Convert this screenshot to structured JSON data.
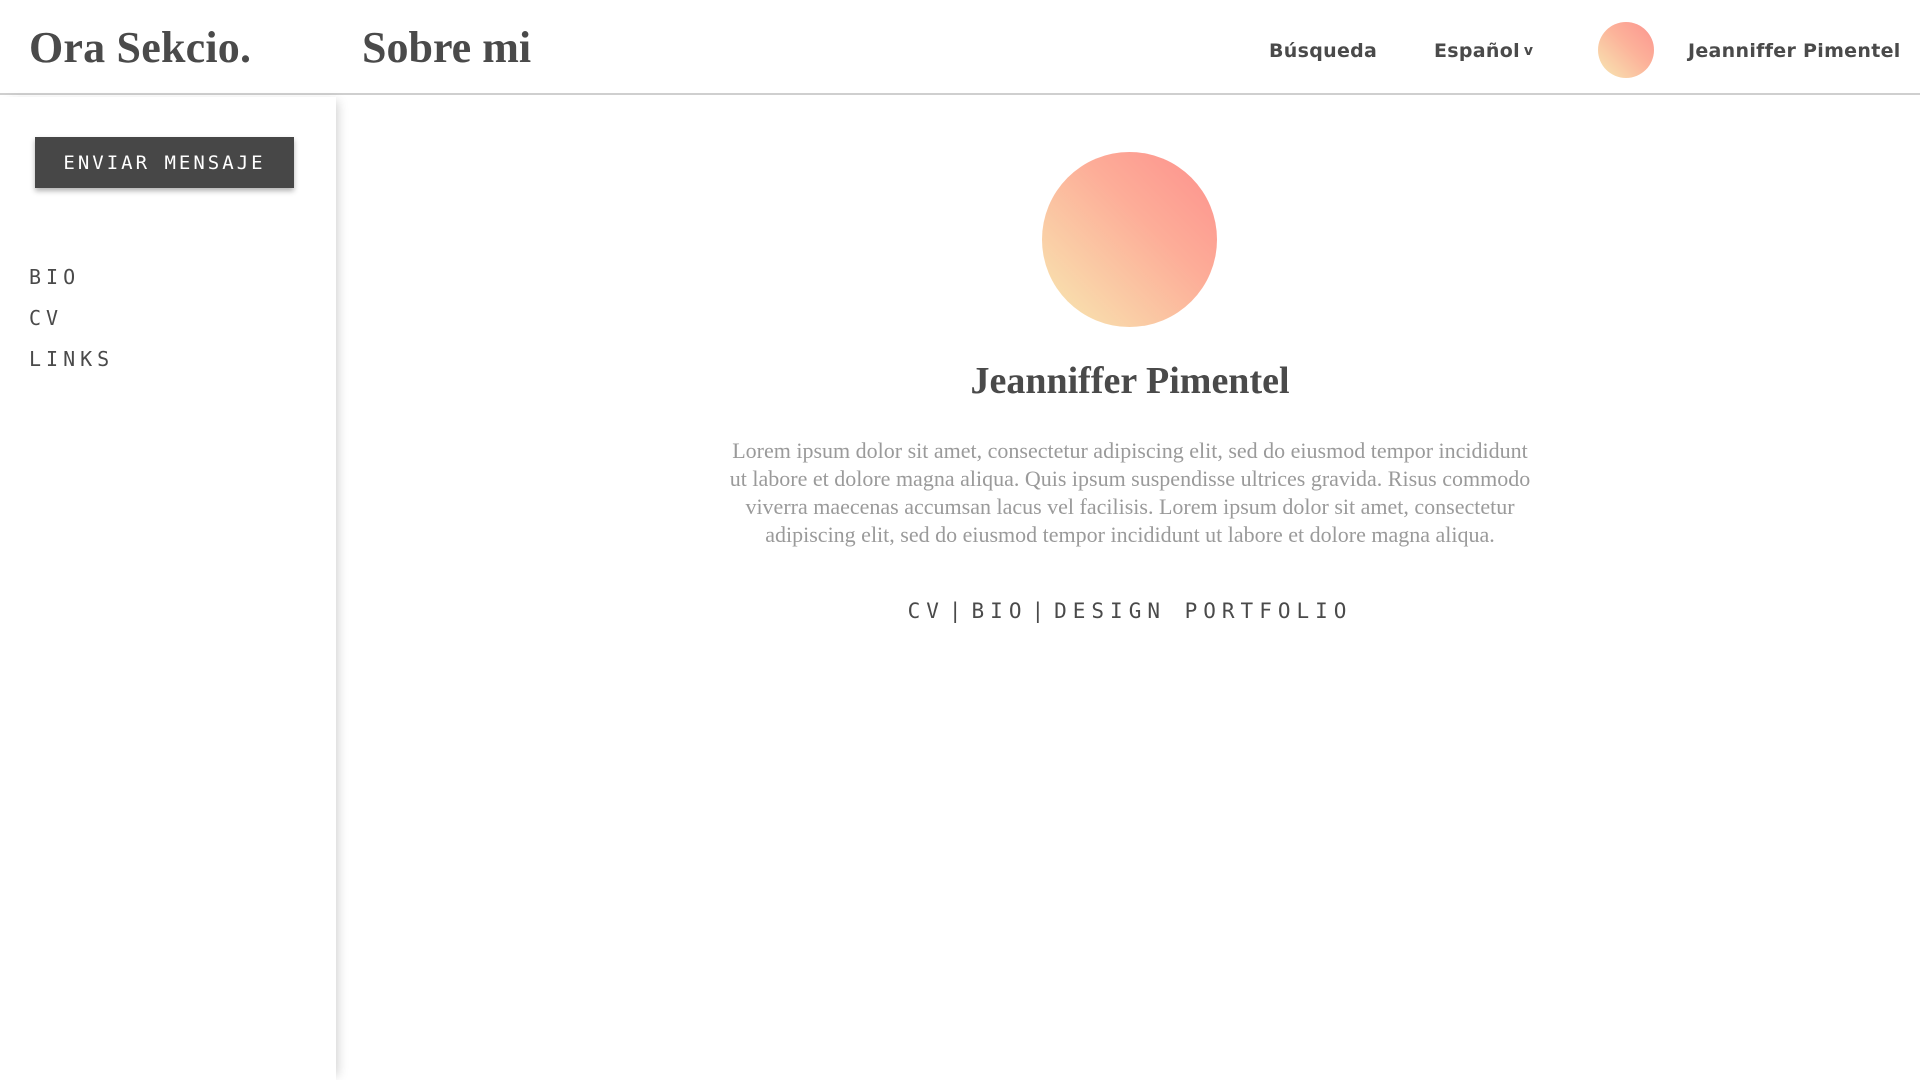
{
  "header": {
    "brand": "Ora Sekcio.",
    "title": "Sobre mi",
    "search_label": "Búsqueda",
    "language_label": "Español",
    "language_chevron": "v",
    "user_name": "Jeanniffer Pimentel"
  },
  "sidebar": {
    "send_button_label": "ENVIAR MENSAJE",
    "items": [
      {
        "label": "BIO"
      },
      {
        "label": "CV"
      },
      {
        "label": "LINKS"
      }
    ]
  },
  "profile": {
    "name": "Jeanniffer Pimentel",
    "bio": "Lorem ipsum dolor sit amet, consectetur adipiscing elit, sed do eiusmod tempor incididunt ut labore et dolore magna aliqua. Quis ipsum suspendisse ultrices gravida. Risus commodo viverra maecenas accumsan lacus vel facilisis. Lorem ipsum dolor sit amet, consectetur adipiscing elit, sed do eiusmod tempor incididunt ut labore et dolore magna aliqua.",
    "links": [
      {
        "label": "CV"
      },
      {
        "label": "BIO"
      },
      {
        "label": "DESIGN PORTFOLIO"
      }
    ],
    "separator": "|"
  },
  "colors": {
    "text_primary": "#4a4a4a",
    "text_muted": "#9a9a9a",
    "button_bg": "#474747",
    "avatar_gradient_start": "#fd8f8c",
    "avatar_gradient_end": "#f7eab2"
  }
}
